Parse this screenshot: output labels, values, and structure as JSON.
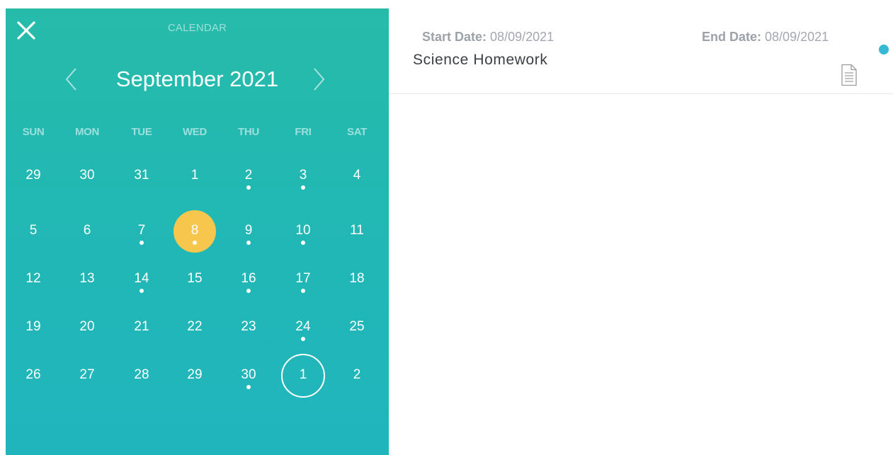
{
  "calendar": {
    "title": "CALENDAR",
    "month_label": "September 2021",
    "weekdays": [
      "SUN",
      "MON",
      "TUE",
      "WED",
      "THU",
      "FRI",
      "SAT"
    ],
    "weeks": [
      [
        {
          "d": "29",
          "dot": false
        },
        {
          "d": "30",
          "dot": false
        },
        {
          "d": "31",
          "dot": false
        },
        {
          "d": "1",
          "dot": false
        },
        {
          "d": "2",
          "dot": true
        },
        {
          "d": "3",
          "dot": true
        },
        {
          "d": "4",
          "dot": false
        }
      ],
      [
        {
          "d": "5",
          "dot": false
        },
        {
          "d": "6",
          "dot": false
        },
        {
          "d": "7",
          "dot": true
        },
        {
          "d": "8",
          "dot": true,
          "selected": true
        },
        {
          "d": "9",
          "dot": true
        },
        {
          "d": "10",
          "dot": true
        },
        {
          "d": "11",
          "dot": false
        }
      ],
      [
        {
          "d": "12",
          "dot": false
        },
        {
          "d": "13",
          "dot": false
        },
        {
          "d": "14",
          "dot": true
        },
        {
          "d": "15",
          "dot": false
        },
        {
          "d": "16",
          "dot": true
        },
        {
          "d": "17",
          "dot": true
        },
        {
          "d": "18",
          "dot": false
        }
      ],
      [
        {
          "d": "19",
          "dot": false
        },
        {
          "d": "20",
          "dot": false
        },
        {
          "d": "21",
          "dot": false
        },
        {
          "d": "22",
          "dot": false
        },
        {
          "d": "23",
          "dot": false
        },
        {
          "d": "24",
          "dot": true
        },
        {
          "d": "25",
          "dot": false
        }
      ],
      [
        {
          "d": "26",
          "dot": false
        },
        {
          "d": "27",
          "dot": false
        },
        {
          "d": "28",
          "dot": false
        },
        {
          "d": "29",
          "dot": false
        },
        {
          "d": "30",
          "dot": true
        },
        {
          "d": "1",
          "dot": false,
          "today": true
        },
        {
          "d": "2",
          "dot": false
        }
      ]
    ],
    "icons": {
      "close": "close-icon",
      "prev": "chevron-left-icon",
      "next": "chevron-right-icon"
    }
  },
  "event": {
    "start_label": "Start Date:",
    "start_value": "08/09/2021",
    "end_label": "End Date:",
    "end_value": "08/09/2021",
    "title": "Science Homework",
    "status_color": "#36b8d4",
    "icon": "document-icon"
  },
  "colors": {
    "panel": "#22b8b2",
    "selected_day": "#f6c64d"
  }
}
